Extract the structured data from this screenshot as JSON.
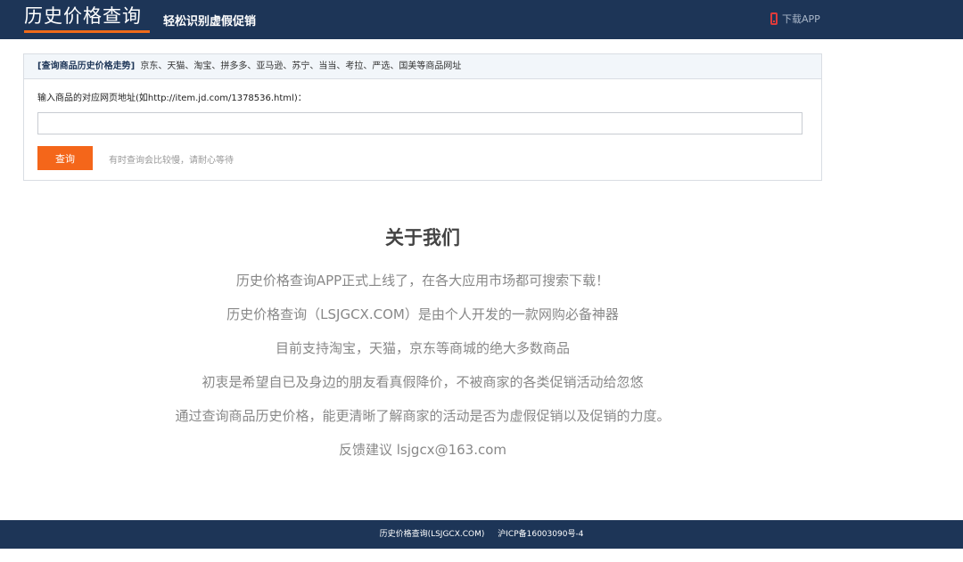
{
  "header": {
    "logo": "历史价格查询",
    "slogan": "轻松识别虚假促销",
    "download_label": "下载APP",
    "icon": "phone-icon"
  },
  "query": {
    "title": "[查询商品历史价格走势]",
    "sites": "京东、天猫、淘宝、拼多多、亚马逊、苏宁、当当、考拉、严选、国美等商品网址",
    "input_label": "输入商品的对应网页地址(如http://item.jd.com/1378536.html)：",
    "input_value": "",
    "input_placeholder": "",
    "button_label": "查询",
    "hint": "有时查询会比较慢，请耐心等待"
  },
  "about": {
    "title": "关于我们",
    "lines": [
      "历史价格查询APP正式上线了，在各大应用市场都可搜索下载！",
      "历史价格查询（LSJGCX.COM）是由个人开发的一款网购必备神器",
      "目前支持淘宝，天猫，京东等商城的绝大多数商品",
      "初衷是希望自已及身边的朋友看真假降价，不被商家的各类促销活动给忽悠",
      "通过查询商品历史价格，能更清晰了解商家的活动是否为虚假促销以及促销的力度。",
      "反馈建议 lsjgcx@163.com"
    ]
  },
  "footer": {
    "site": "历史价格查询(LSJGCX.COM)",
    "icp": "沪ICP备16003090号-4"
  },
  "colors": {
    "header_bg": "#1d3557",
    "accent": "#f4661a",
    "phone_icon": "#e03b3b"
  }
}
